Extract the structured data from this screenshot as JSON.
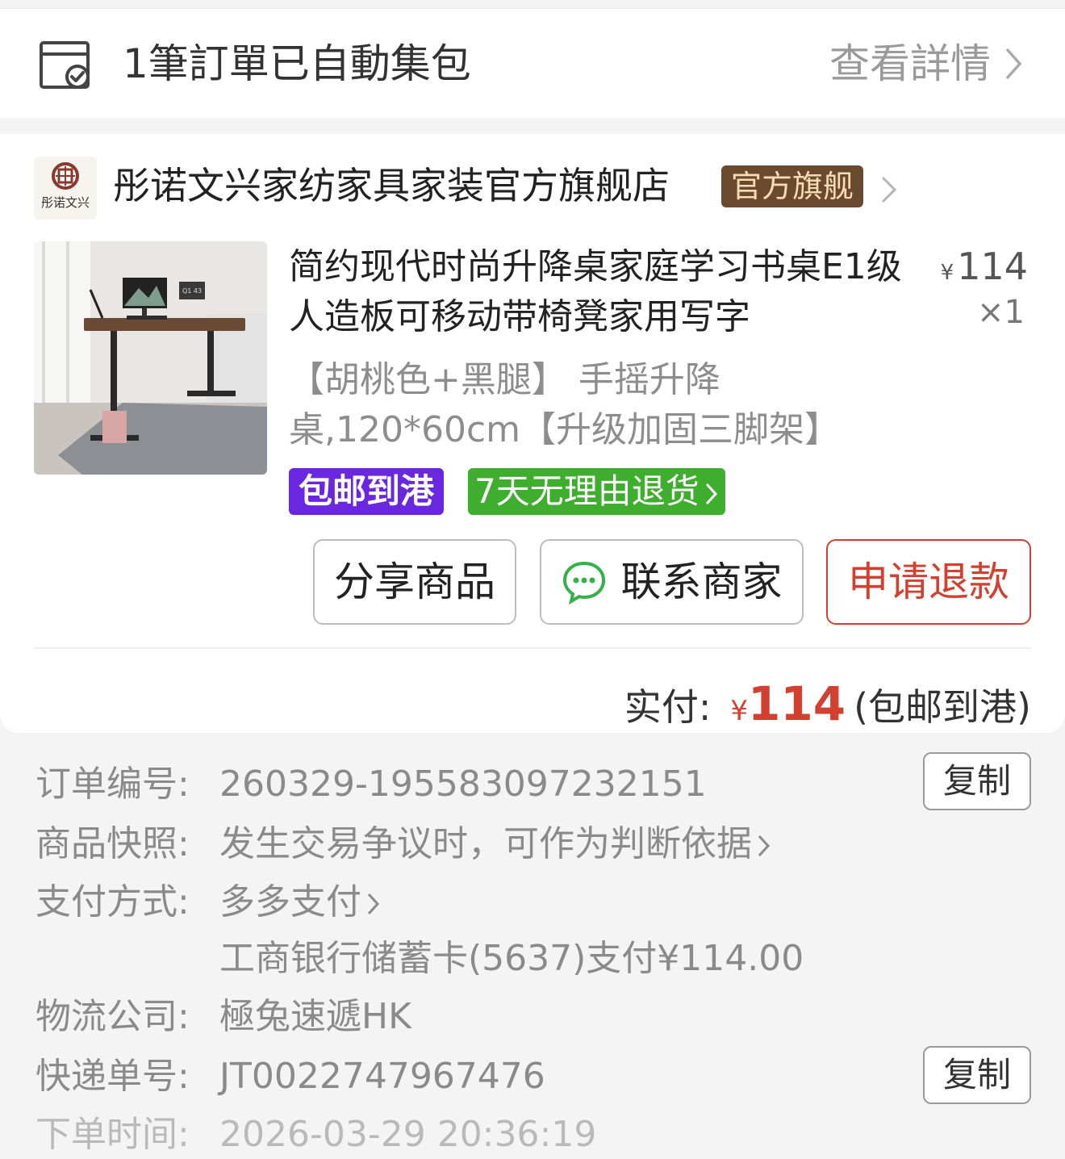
{
  "bundle": {
    "text": "1筆訂單已自動集包",
    "link": "查看詳情"
  },
  "shop": {
    "logo_text": "彤诺文兴",
    "name": "彤诺文兴家纺家具家装官方旗舰店",
    "badge": "官方旗舰"
  },
  "product": {
    "title": "简约现代时尚升降桌家庭学习书桌E1级人造板可移动带椅凳家用写字",
    "price_symbol": "¥",
    "price": "114",
    "qty": "×1",
    "spec": "【胡桃色+黑腿】 手摇升降桌,120*60cm【升级加固三脚架】",
    "tag_shipping": "包邮到港",
    "tag_return": "7天无理由退货",
    "image_screen_text": "Q1 43"
  },
  "actions": {
    "share": "分享商品",
    "contact": "联系商家",
    "refund": "申请退款"
  },
  "payment": {
    "label": "实付:",
    "symbol": "¥",
    "amount": "114",
    "note": "(包邮到港)"
  },
  "colors": {
    "accent_red": "#d2412f",
    "purple_tag": "#6a27e0",
    "green_tag": "#3fae2e",
    "badge_brown": "#6a4a2e"
  },
  "details": {
    "order_no_label": "订单编号:",
    "order_no": "260329-195583097232151",
    "copy": "复制",
    "snapshot_label": "商品快照:",
    "snapshot": "发生交易争议时，可作为判断依据",
    "paymethod_label": "支付方式:",
    "paymethod": "多多支付",
    "paymethod_detail": "工商银行储蓄卡(5637)支付¥114.00",
    "logistics_label": "物流公司:",
    "logistics": "極兔速遞HK",
    "tracking_label": "快递单号:",
    "tracking": "JT0022747967476",
    "time_label": "下单时间:",
    "time": "2026-03-29 20:36:19"
  }
}
